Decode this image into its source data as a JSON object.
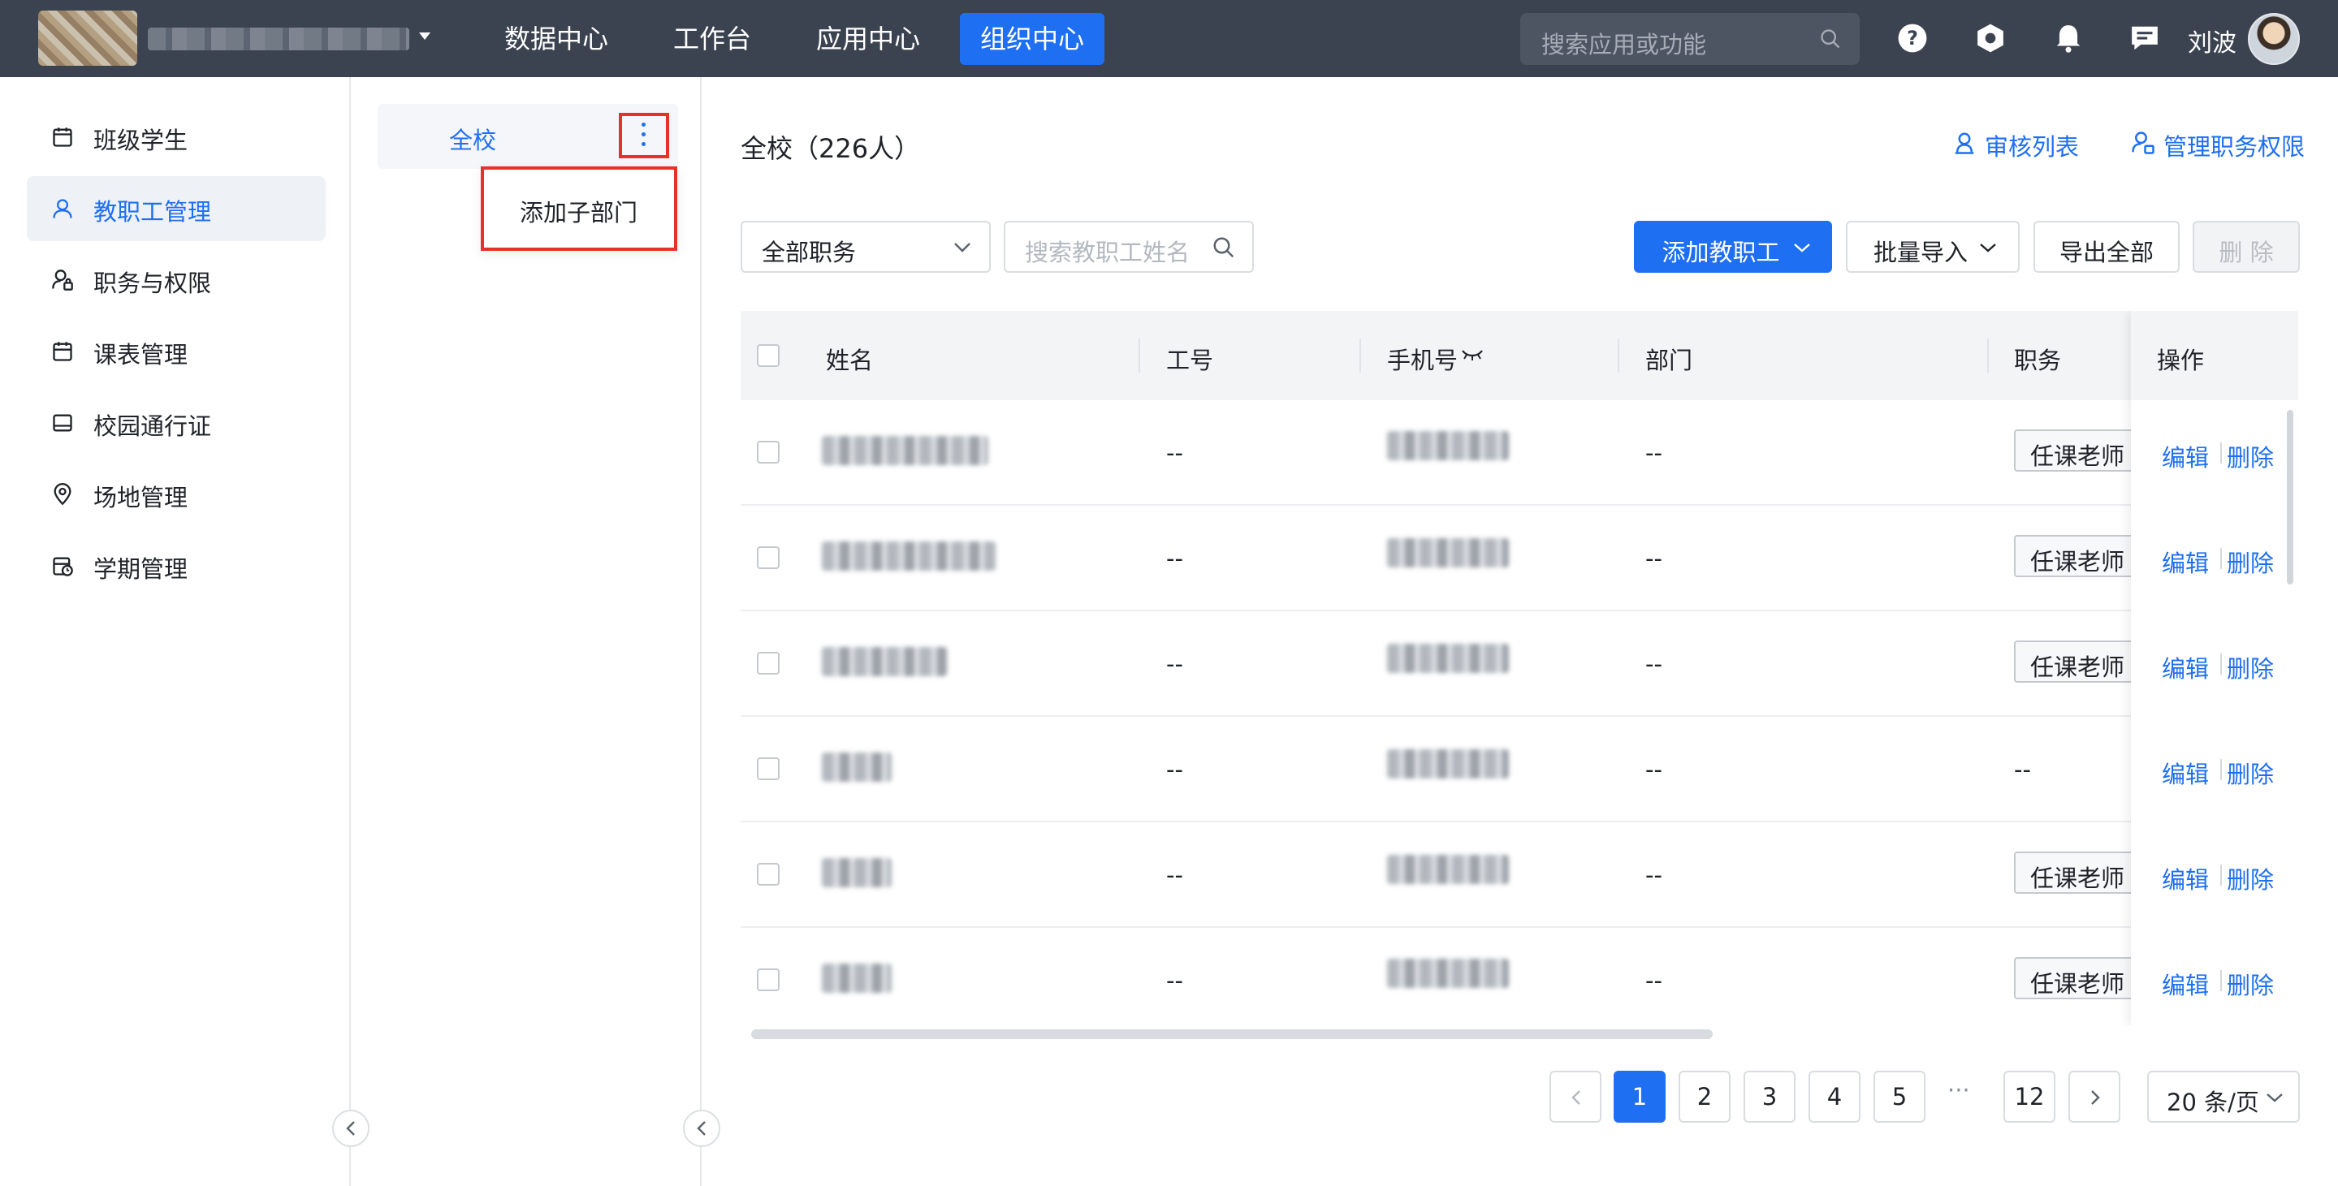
{
  "topbar": {
    "nav": [
      "数据中心",
      "工作台",
      "应用中心",
      "组织中心"
    ],
    "active_nav": "组织中心",
    "search_placeholder": "搜索应用或功能",
    "user_name": "刘波",
    "icons": [
      "help-icon",
      "settings-icon",
      "bell-icon",
      "message-icon"
    ]
  },
  "sidebar": {
    "items": [
      {
        "label": "班级学生",
        "icon": "class-icon"
      },
      {
        "label": "教职工管理",
        "icon": "user-icon",
        "active": true
      },
      {
        "label": "职务与权限",
        "icon": "user-lock-icon"
      },
      {
        "label": "课表管理",
        "icon": "calendar-icon"
      },
      {
        "label": "校园通行证",
        "icon": "card-icon"
      },
      {
        "label": "场地管理",
        "icon": "location-icon"
      },
      {
        "label": "学期管理",
        "icon": "calendar-clock-icon"
      }
    ]
  },
  "dept": {
    "root": "全校",
    "menu_item": "添加子部门"
  },
  "main": {
    "title": "全校（226人）",
    "review_link": "审核列表",
    "perm_link": "管理职务权限",
    "role_filter": "全部职务",
    "name_search_placeholder": "搜索教职工姓名",
    "buttons": {
      "add": "添加教职工",
      "import": "批量导入",
      "export": "导出全部",
      "delete": "删 除"
    }
  },
  "table": {
    "headers": [
      "姓名",
      "工号",
      "手机号",
      "部门",
      "职务",
      "操作"
    ],
    "rows": [
      {
        "job_no": "--",
        "dept": "--",
        "role": "任课老师"
      },
      {
        "job_no": "--",
        "dept": "--",
        "role": "任课老师"
      },
      {
        "job_no": "--",
        "dept": "--",
        "role": "任课老师"
      },
      {
        "job_no": "--",
        "dept": "--",
        "role": "--"
      },
      {
        "job_no": "--",
        "dept": "--",
        "role": "任课老师"
      },
      {
        "job_no": "--",
        "dept": "--",
        "role": "任课老师"
      }
    ],
    "op_edit": "编辑",
    "op_delete": "删除"
  },
  "pagination": {
    "pages": [
      "1",
      "2",
      "3",
      "4",
      "5",
      "12"
    ],
    "current": "1",
    "ellipsis": "···",
    "page_size": "20 条/页"
  },
  "colors": {
    "primary": "#1e6ff2",
    "topbar": "#3b4350",
    "highlight": "#e8302a"
  }
}
